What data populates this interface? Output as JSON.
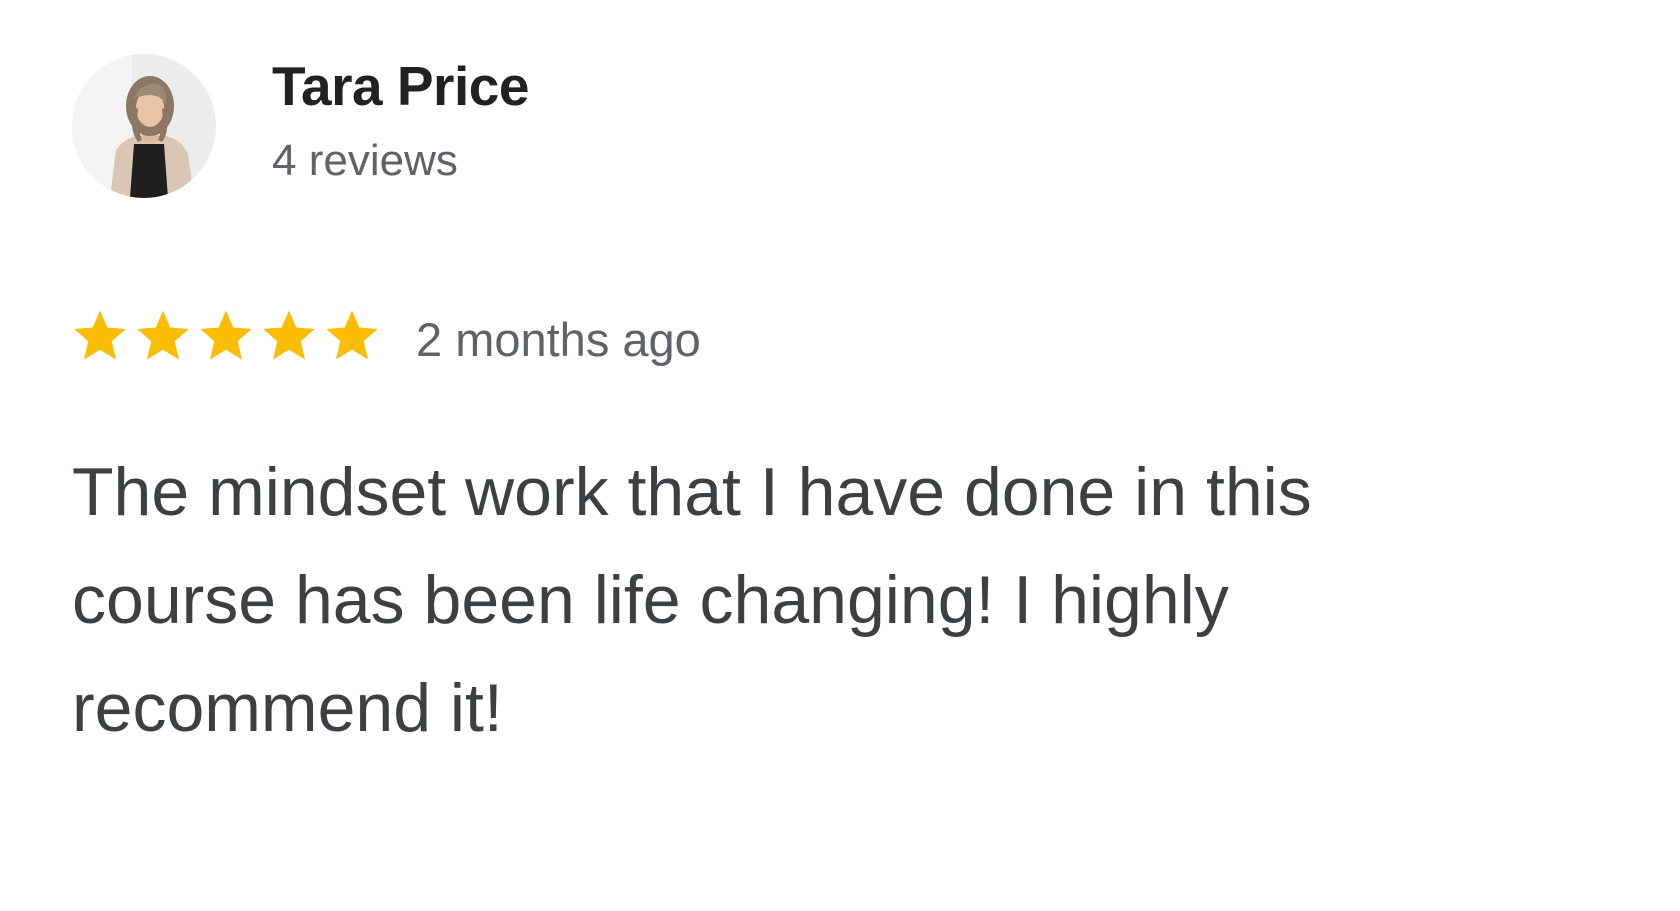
{
  "reviewer": {
    "name": "Tara Price",
    "review_count": "4 reviews",
    "avatar_icon": "person-photo"
  },
  "review": {
    "rating": 5,
    "rating_max": 5,
    "star_icon": "star-icon",
    "star_color": "#FBBC04",
    "date": "2 months ago",
    "text": "The mindset work that I have done in this course has been life changing! I highly recommend it!"
  }
}
